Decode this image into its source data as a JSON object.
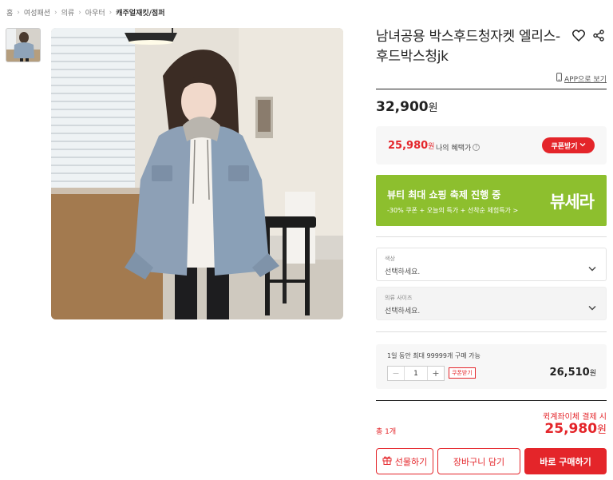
{
  "breadcrumb": {
    "items": [
      "홈",
      "여성패션",
      "의류",
      "아우터"
    ],
    "current": "캐주얼재킷/점퍼"
  },
  "product": {
    "title": "남녀공용 박스후드청자켓 엘리스-후드박스청jk",
    "app_link": "APP으로 보기",
    "price": "32,900",
    "currency": "원"
  },
  "benefit": {
    "price": "25,980",
    "currency": "원",
    "label": "나의 혜택가",
    "coupon_label": "쿠폰받기"
  },
  "banner": {
    "title": "뷰티 최대 쇼핑 축제 진행 중",
    "subtitle": "-30% 쿠폰 + 오늘의 특가 + 선착순 체험특가 >",
    "brand": "뷰세라",
    "color": "#8dbf2e"
  },
  "options": [
    {
      "label": "색상",
      "value": "선택하세요."
    },
    {
      "label": "의류 사이즈",
      "value": "선택하세요."
    }
  ],
  "quantity": {
    "limit_text": "1일 동안 최대 99999개 구매 가능",
    "value": "1",
    "minus": "−",
    "plus": "+",
    "coupon_label": "쿠폰받기",
    "price": "26,510",
    "currency": "원"
  },
  "summary": {
    "pay_note": "퀵계좌이체 결제 시",
    "total_label": "총 1개",
    "total_price": "25,980",
    "currency": "원"
  },
  "actions": {
    "gift": "선물하기",
    "cart": "장바구니 담기",
    "buy": "바로 구매하기"
  },
  "colors": {
    "accent": "#e4252a",
    "banner": "#8dbf2e"
  },
  "icons": [
    "heart-icon",
    "share-icon",
    "phone-icon",
    "info-icon",
    "chevron-down-icon",
    "gift-icon"
  ]
}
